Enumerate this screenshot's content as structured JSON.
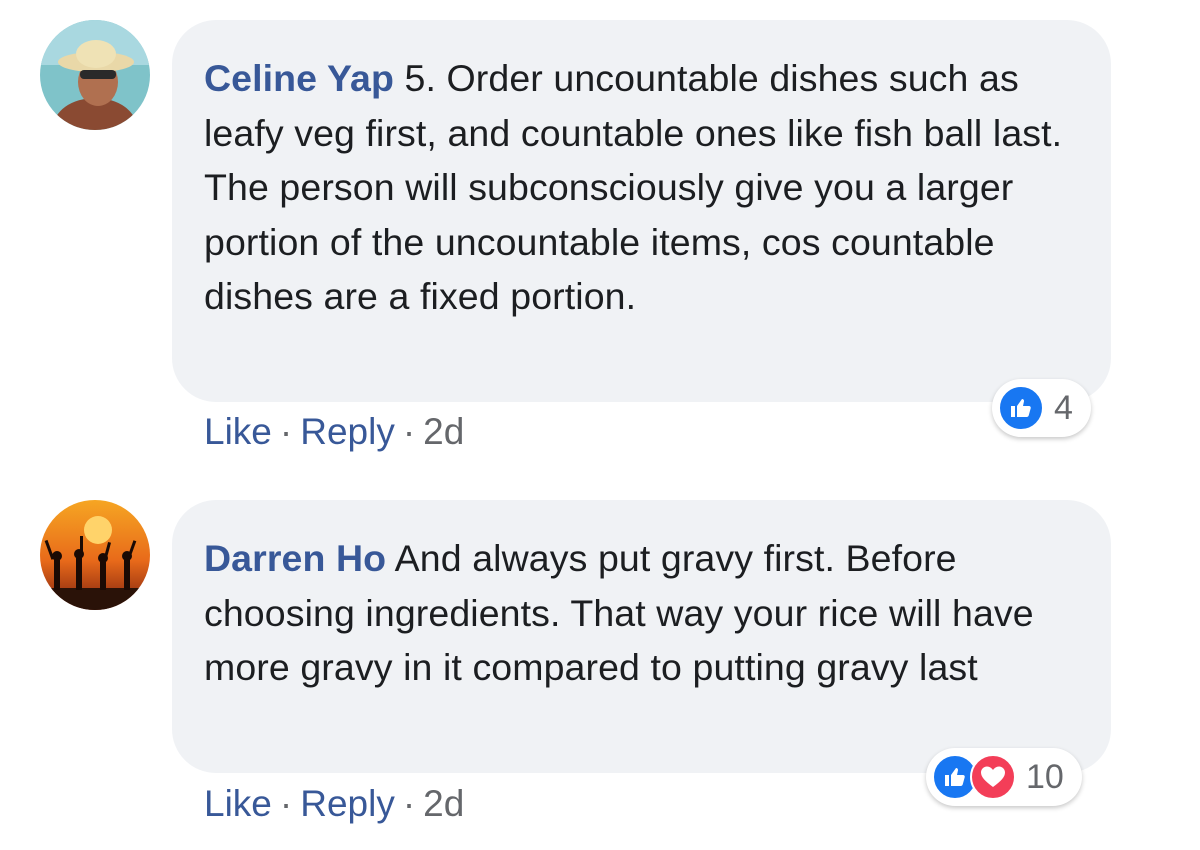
{
  "comments": [
    {
      "author": "Celine Yap",
      "text": "5. Order uncountable dishes such as leafy veg first, and countable ones like fish ball last. The person will subconsciously give you a larger portion of the uncountable items, cos countable dishes are a fixed portion.",
      "like_label": "Like",
      "reply_label": "Reply",
      "separator": "·",
      "time": "2d",
      "reaction_count": "4",
      "reaction_icons": [
        "like-icon"
      ]
    },
    {
      "author": "Darren Ho",
      "text": "And always put gravy first. Before choosing ingredients. That way your rice will have more gravy in it compared to putting gravy last",
      "like_label": "Like",
      "reply_label": "Reply",
      "separator": "·",
      "time": "2d",
      "reaction_count": "10",
      "reaction_icons": [
        "like-icon",
        "love-icon"
      ]
    }
  ],
  "colors": {
    "author": "#385898",
    "bubble_bg": "#f0f2f5",
    "text": "#1c1e21",
    "meta": "#65676b",
    "like_blue": "#1877f2",
    "love_red": "#f33e58"
  }
}
